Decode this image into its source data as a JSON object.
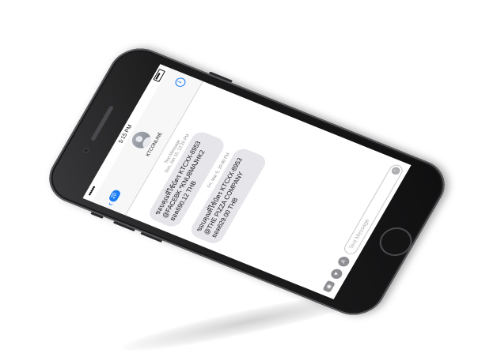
{
  "statusbar": {
    "time": "5:15 PM"
  },
  "header": {
    "back_count": "20",
    "contact_name": "KTCONLINE"
  },
  "thread": {
    "first_meta_label": "Text Message",
    "first_meta_time": "Sun, Jan 15, 12:29 PM",
    "messages": [
      {
        "lines": [
          "ขอบคุณที่ใช้บัตร KTCXX-8953",
          "@FACEBK *KNU8MAJHK2",
          "ยอด690.12 THB"
        ]
      },
      {
        "lines": [
          "ขอบคุณที่ใช้บัตร KTCXX-8953",
          "@THE PIZZA COMPANY",
          "ยอด629.00 THB"
        ]
      }
    ],
    "second_meta_time": "Fri, Mar 5, 10:30 PM"
  },
  "composer": {
    "placeholder": "Text Message",
    "camera_icon": "camera-icon",
    "heart_icon": "digital-touch-icon",
    "apps_icon": "app-store-icon",
    "send_icon": "send-arrow-icon"
  },
  "colors": {
    "accent": "#1c7cf4",
    "bubble": "#e5e5ea",
    "phone_body": "#1c1c1d"
  }
}
